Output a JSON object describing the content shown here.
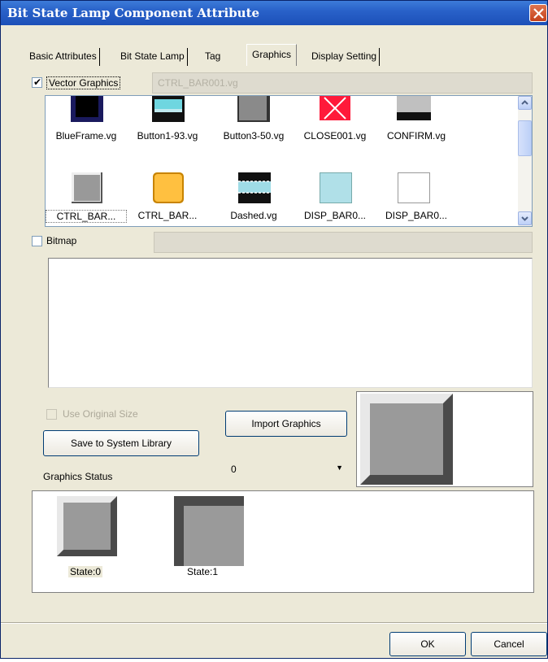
{
  "window": {
    "title": "Bit State Lamp Component Attribute",
    "close_icon": "close-icon"
  },
  "tabs": [
    {
      "label": "Basic Attributes"
    },
    {
      "label": "Bit State Lamp"
    },
    {
      "label": "Tag"
    },
    {
      "label": "Graphics",
      "active": true
    },
    {
      "label": "Display Setting"
    }
  ],
  "vector_graphics": {
    "checkbox_label": "Vector Graphics",
    "checked": true,
    "selected_file": "CTRL_BAR001.vg",
    "items": [
      {
        "name": "BlueFrame.vg"
      },
      {
        "name": "Button1-93.vg"
      },
      {
        "name": "Button3-50.vg"
      },
      {
        "name": "CLOSE001.vg"
      },
      {
        "name": "CONFIRM.vg"
      },
      {
        "name": "CTRL_BAR..."
      },
      {
        "name": "CTRL_BAR..."
      },
      {
        "name": "Dashed.vg"
      },
      {
        "name": "DISP_BAR0..."
      },
      {
        "name": "DISP_BAR0..."
      }
    ]
  },
  "bitmap": {
    "checkbox_label": "Bitmap",
    "checked": false
  },
  "options": {
    "use_original_size": "Use Original Size",
    "save_to_library": "Save to System Library",
    "import_graphics": "Import Graphics",
    "graphics_status": "Graphics Status",
    "state_select": "0"
  },
  "states": [
    {
      "label": "State:0"
    },
    {
      "label": "State:1"
    }
  ],
  "footer": {
    "ok": "OK",
    "cancel": "Cancel"
  },
  "colors": {
    "title_bar": "#2962c9",
    "dialog_bg": "#ece9d8",
    "thumb_gray": "#999999"
  }
}
